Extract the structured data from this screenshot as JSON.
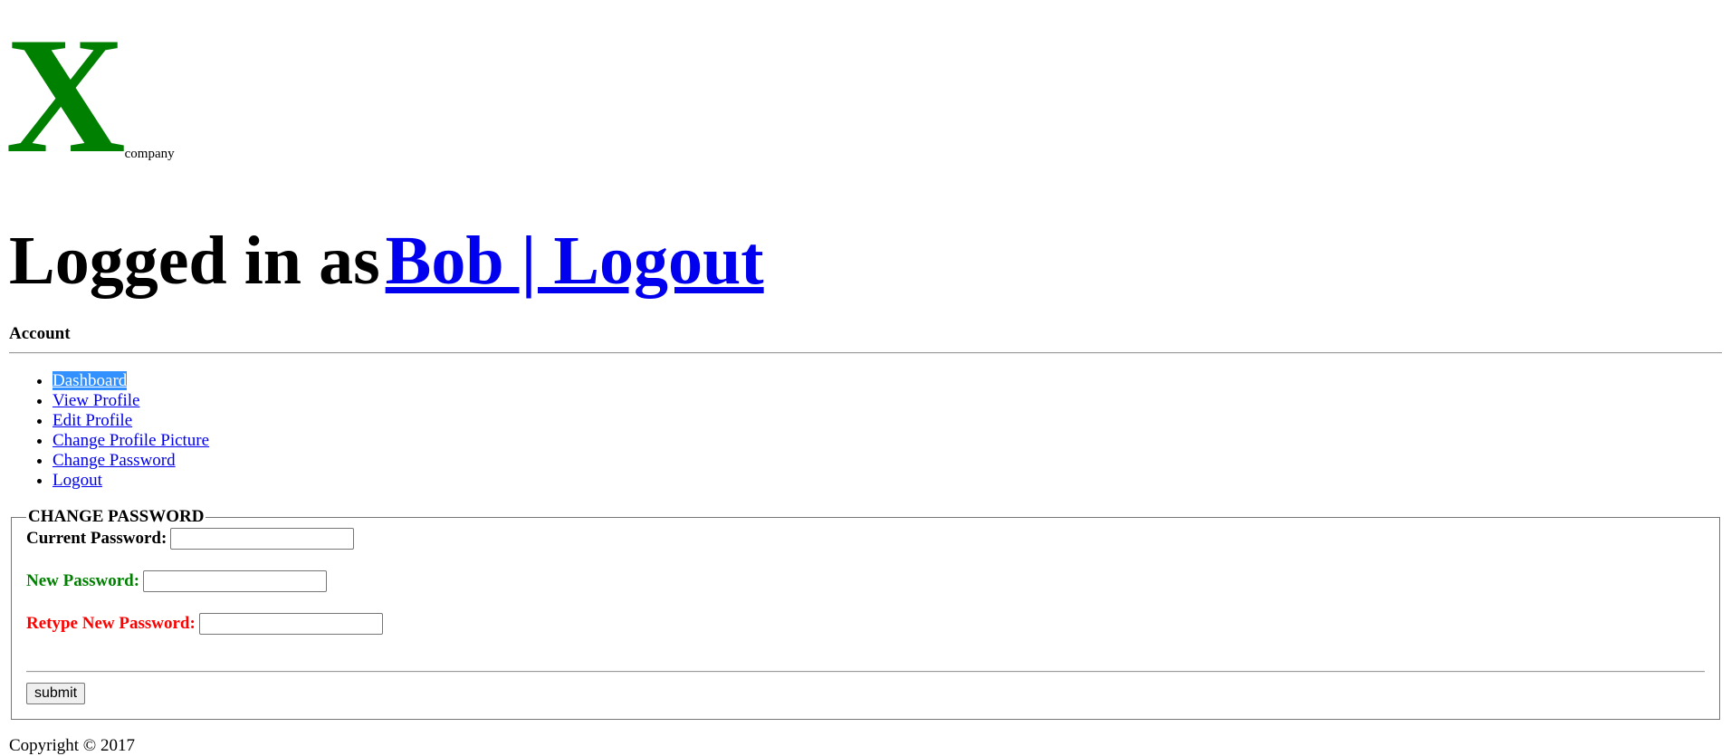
{
  "logo": {
    "mark": "X",
    "subtitle": "company"
  },
  "header": {
    "logged_in_prefix": "Logged in as",
    "user_logout_link": "Bob | Logout"
  },
  "account_label": "Account",
  "menu": {
    "items": [
      {
        "label": "Dashboard",
        "selected": true
      },
      {
        "label": "View Profile"
      },
      {
        "label": "Edit Profile"
      },
      {
        "label": "Change Profile Picture"
      },
      {
        "label": "Change Password"
      },
      {
        "label": "Logout"
      }
    ]
  },
  "change_password": {
    "legend": "CHANGE PASSWORD",
    "current_label": "Current Password:",
    "current_value": "",
    "new_label": "New Password:",
    "new_value": "",
    "retype_label": "Retype New Password:",
    "retype_value": "",
    "submit_label": "submit"
  },
  "footer": {
    "copyright": "Copyright © 2017"
  },
  "colors": {
    "logo_green": "#008000",
    "link_blue": "#0000ee",
    "new_label_green": "#008000",
    "retype_label_red": "#ff0000",
    "selection_blue": "#3390ff"
  }
}
